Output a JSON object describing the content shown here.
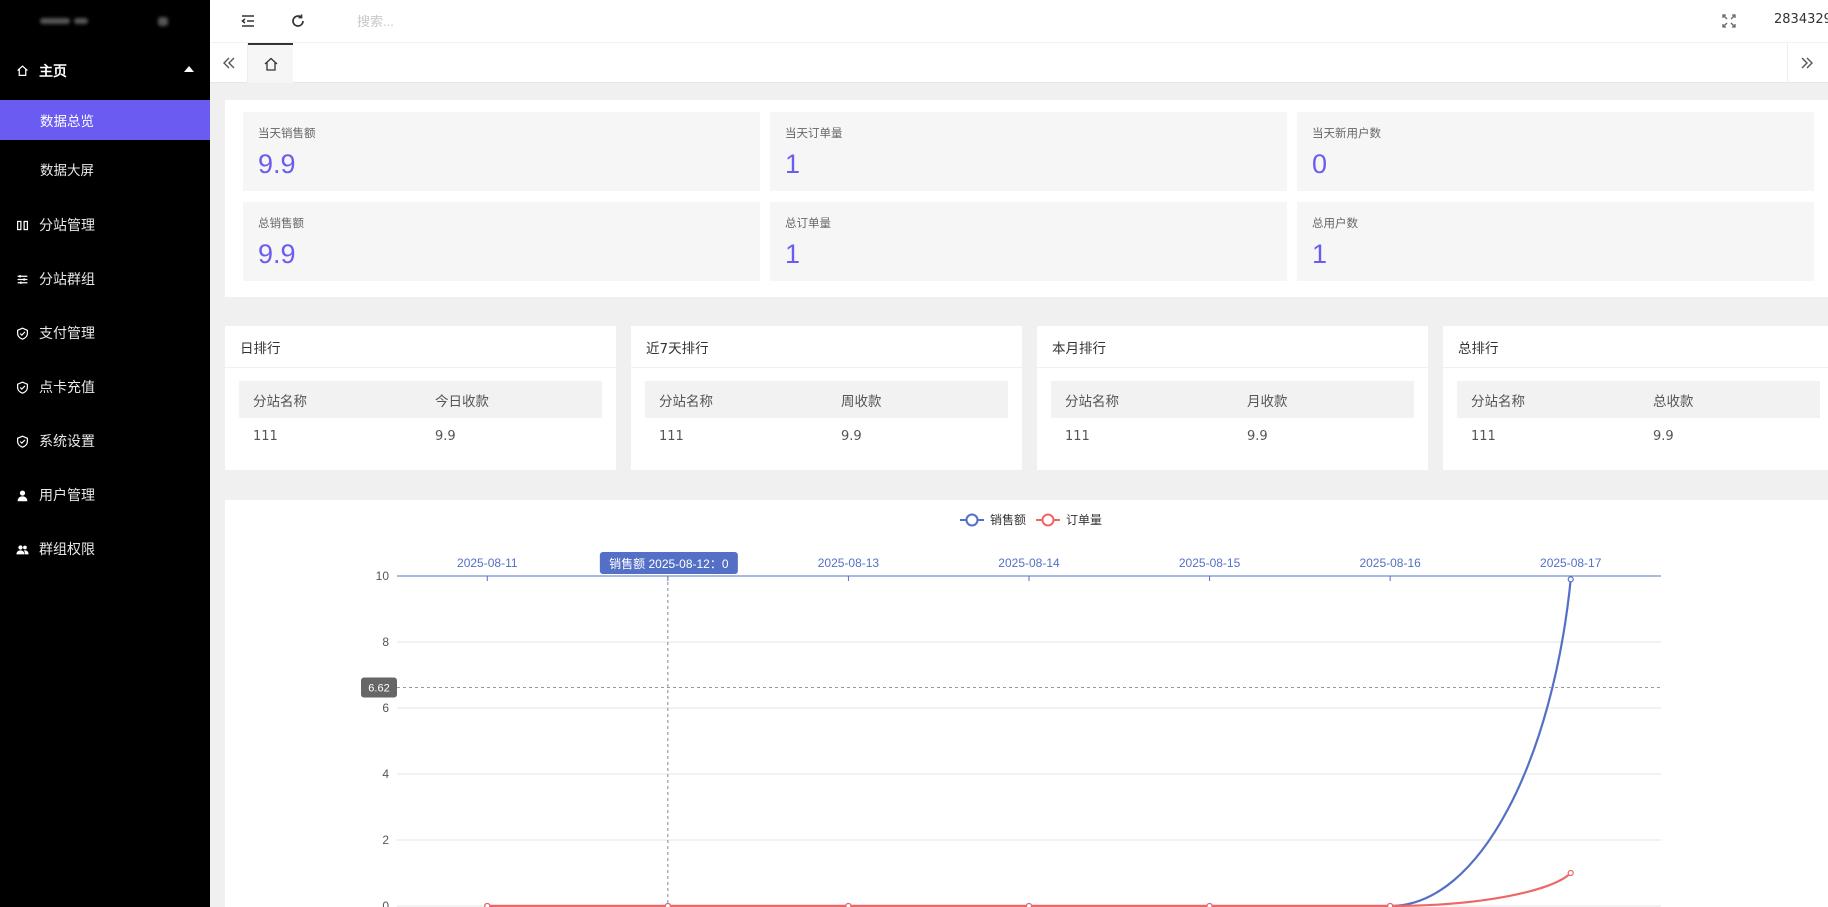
{
  "sidebar": {
    "home": {
      "label": "主页",
      "icon": "home-icon"
    },
    "sub_items": [
      {
        "label": "数据总览",
        "active": true
      },
      {
        "label": "数据大屏",
        "active": false
      }
    ],
    "items": [
      {
        "label": "分站管理",
        "icon": "columns-icon"
      },
      {
        "label": "分站群组",
        "icon": "sliders-icon"
      },
      {
        "label": "支付管理",
        "icon": "shield-check-icon"
      },
      {
        "label": "点卡充值",
        "icon": "shield-check-icon"
      },
      {
        "label": "系统设置",
        "icon": "shield-check-icon"
      },
      {
        "label": "用户管理",
        "icon": "user-icon"
      },
      {
        "label": "群组权限",
        "icon": "users-icon"
      }
    ],
    "accent": "#6a5cf0"
  },
  "topbar": {
    "search_placeholder": "搜索...",
    "user_id": "2834329"
  },
  "stats": [
    {
      "label": "当天销售额",
      "value": "9.9"
    },
    {
      "label": "当天订单量",
      "value": "1"
    },
    {
      "label": "当天新用户数",
      "value": "0"
    },
    {
      "label": "总销售额",
      "value": "9.9"
    },
    {
      "label": "总订单量",
      "value": "1"
    },
    {
      "label": "总用户数",
      "value": "1"
    }
  ],
  "rankings": [
    {
      "title": "日排行",
      "col1": "分站名称",
      "col2": "今日收款",
      "rows": [
        [
          "111",
          "9.9"
        ]
      ]
    },
    {
      "title": "近7天排行",
      "col1": "分站名称",
      "col2": "周收款",
      "rows": [
        [
          "111",
          "9.9"
        ]
      ]
    },
    {
      "title": "本月排行",
      "col1": "分站名称",
      "col2": "月收款",
      "rows": [
        [
          "111",
          "9.9"
        ]
      ]
    },
    {
      "title": "总排行",
      "col1": "分站名称",
      "col2": "总收款",
      "rows": [
        [
          "111",
          "9.9"
        ]
      ]
    }
  ],
  "chart_data": {
    "type": "line",
    "x": [
      "2025-08-11",
      "2025-08-12",
      "2025-08-13",
      "2025-08-14",
      "2025-08-15",
      "2025-08-16",
      "2025-08-17"
    ],
    "series": [
      {
        "name": "销售额",
        "values": [
          0,
          0,
          0,
          0,
          0,
          0,
          9.9
        ],
        "color": "#5470c6"
      },
      {
        "name": "订单量",
        "values": [
          0,
          0,
          0,
          0,
          0,
          0,
          1
        ],
        "color": "#ee6666"
      }
    ],
    "yticks": [
      "0",
      "2",
      "4",
      "6",
      "8",
      "10"
    ],
    "ylim": [
      0,
      10
    ],
    "smooth": true,
    "legend_position": "top-center",
    "x_axis_position": "top",
    "crosshair": {
      "y_value_label": "6.62",
      "x_tooltip": "销售额  2025-08-12：0"
    }
  }
}
